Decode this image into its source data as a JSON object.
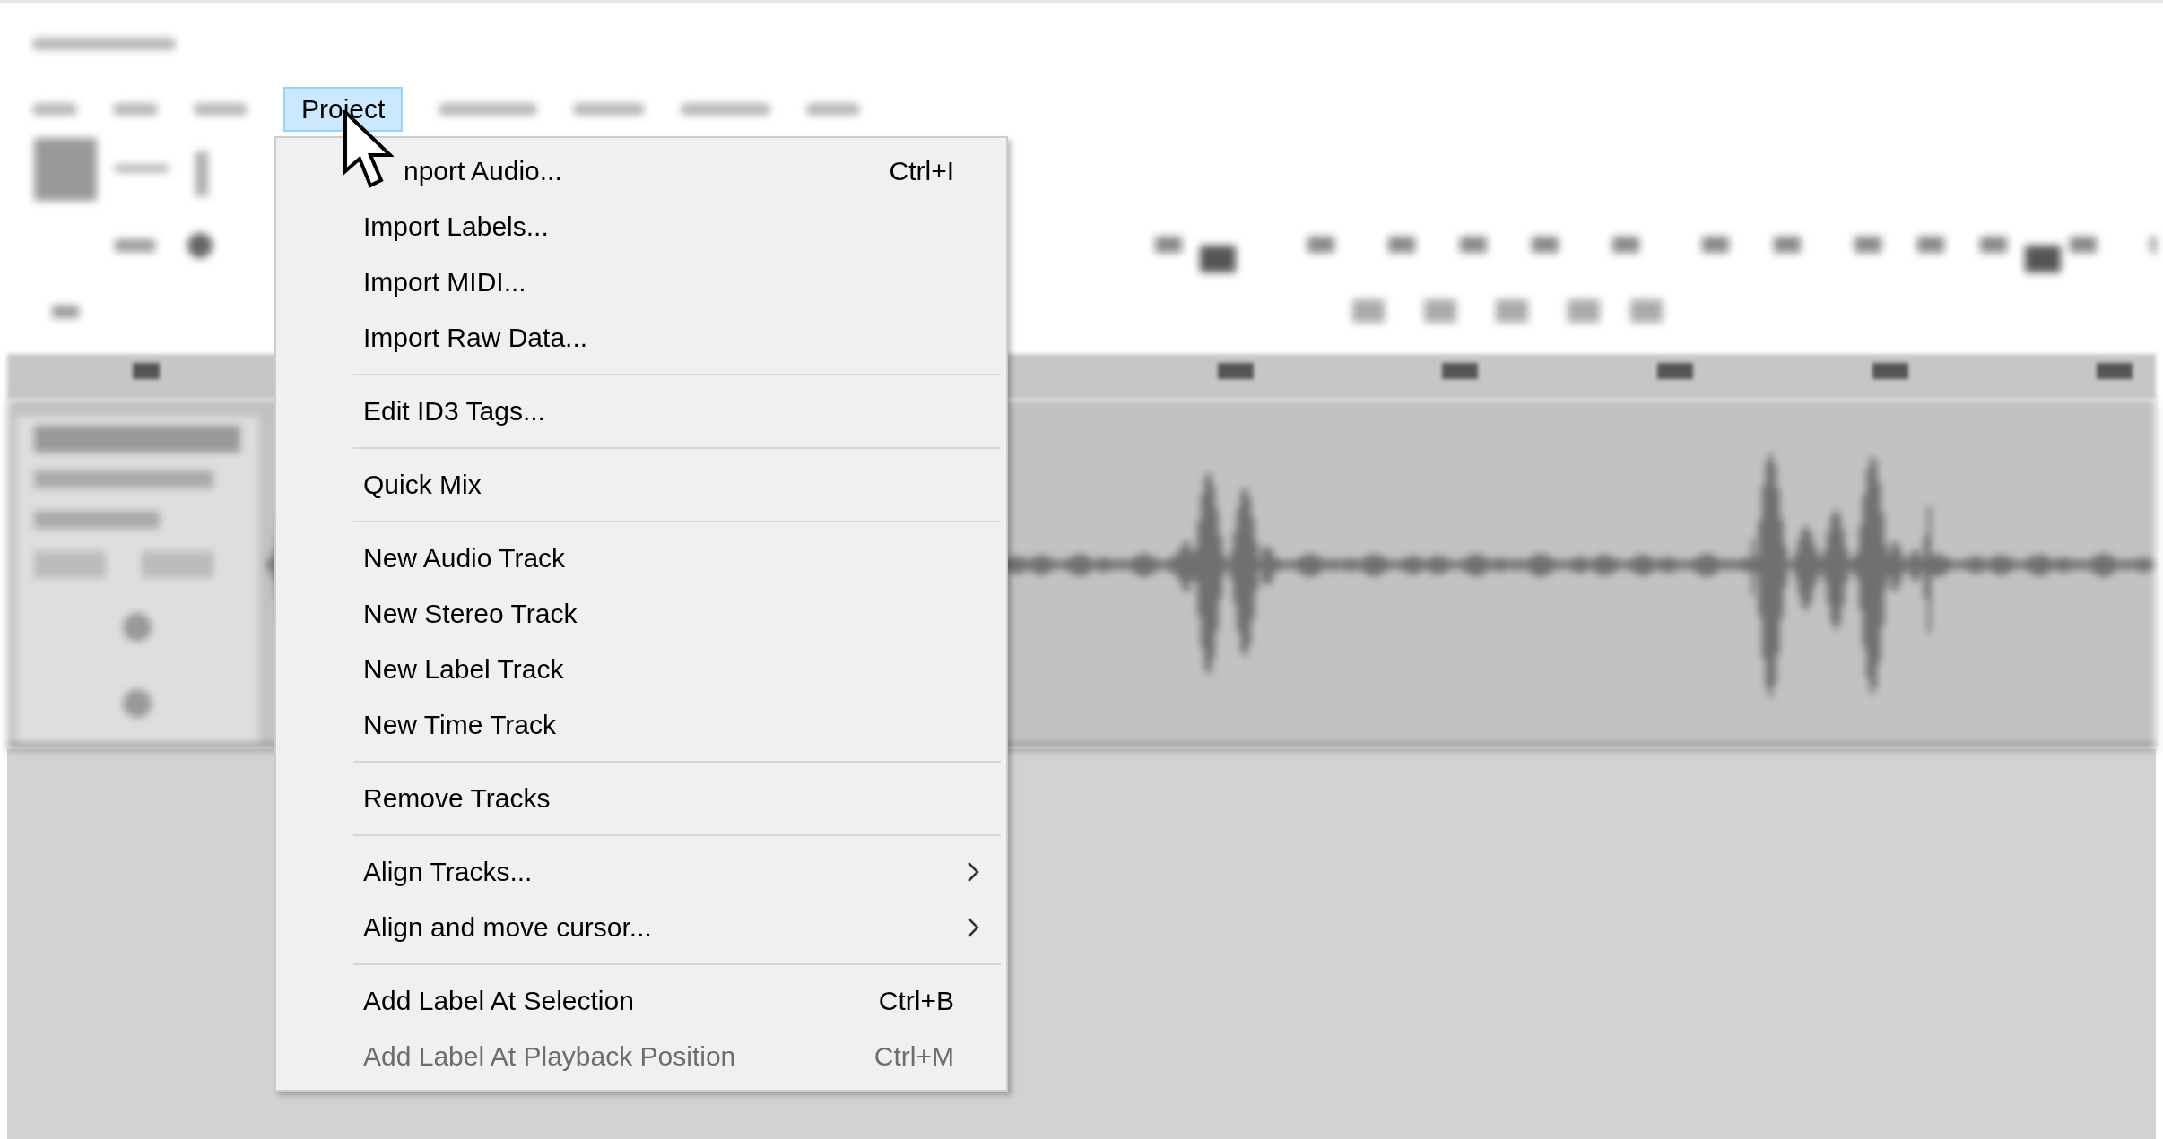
{
  "menu_bar": {
    "items": [
      {
        "label": "Project",
        "selected": true
      }
    ]
  },
  "project_menu": {
    "items": [
      {
        "kind": "item",
        "label": "nport Audio...",
        "shortcut": "Ctrl+I",
        "disabled": false
      },
      {
        "kind": "item",
        "label": "Import Labels...",
        "disabled": false
      },
      {
        "kind": "item",
        "label": "Import MIDI...",
        "disabled": false
      },
      {
        "kind": "item",
        "label": "Import Raw Data...",
        "disabled": false
      },
      {
        "kind": "separator"
      },
      {
        "kind": "item",
        "label": "Edit ID3 Tags...",
        "disabled": false
      },
      {
        "kind": "separator"
      },
      {
        "kind": "item",
        "label": "Quick Mix",
        "disabled": false
      },
      {
        "kind": "separator"
      },
      {
        "kind": "item",
        "label": "New Audio Track",
        "disabled": false
      },
      {
        "kind": "item",
        "label": "New Stereo Track",
        "disabled": false
      },
      {
        "kind": "item",
        "label": "New Label Track",
        "disabled": false
      },
      {
        "kind": "item",
        "label": "New Time Track",
        "disabled": false
      },
      {
        "kind": "separator"
      },
      {
        "kind": "item",
        "label": "Remove Tracks",
        "disabled": false
      },
      {
        "kind": "separator"
      },
      {
        "kind": "submenu",
        "label": "Align Tracks...",
        "disabled": false
      },
      {
        "kind": "submenu",
        "label": "Align and move cursor...",
        "disabled": false
      },
      {
        "kind": "separator"
      },
      {
        "kind": "item",
        "label": "Add Label At Selection",
        "shortcut": "Ctrl+B",
        "disabled": false
      },
      {
        "kind": "item",
        "label": "Add Label At Playback Position",
        "shortcut": "Ctrl+M",
        "disabled": true
      }
    ]
  }
}
